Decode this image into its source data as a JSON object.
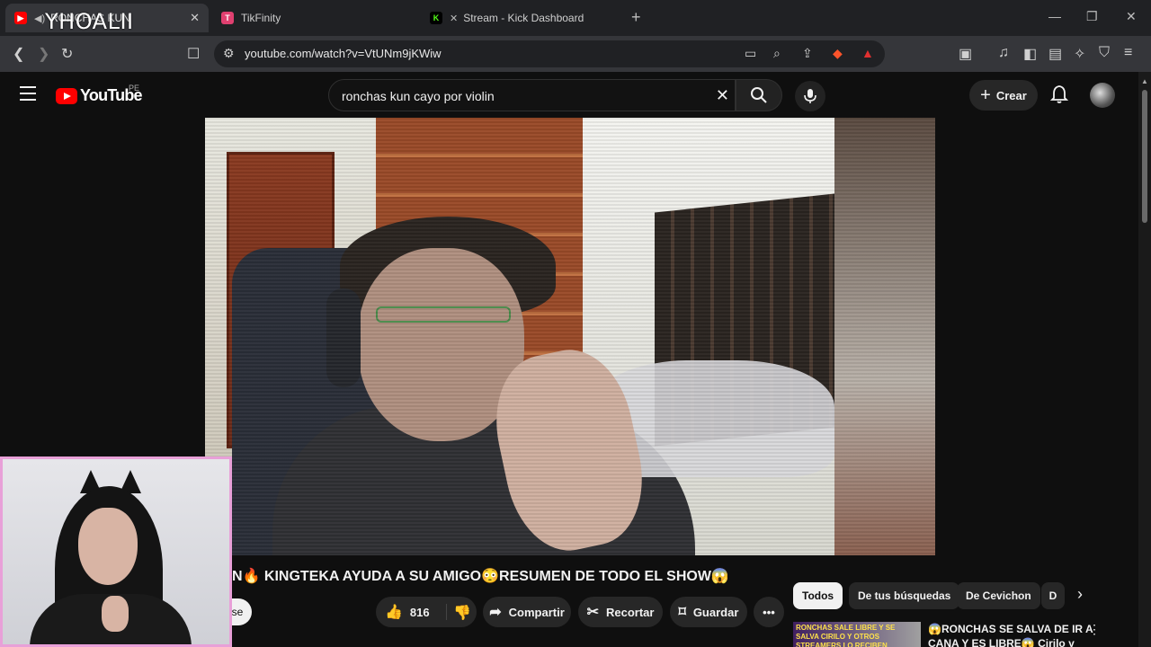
{
  "browser": {
    "tabs": [
      {
        "title": "RONCHAS KUN",
        "favicon": "youtube-favicon",
        "active": true
      },
      {
        "title": "TikFinity",
        "favicon": "tikfinity-favicon",
        "active": false
      },
      {
        "title": "Stream - Kick Dashboard",
        "favicon": "kick-favicon",
        "active": false
      }
    ],
    "overlay_text": "YHOALII",
    "url": "youtube.com/watch?v=VtUNm9jKWiw"
  },
  "youtube": {
    "logo_text": "YouTube",
    "country_code": "PE",
    "search_query": "ronchas kun cayo por violin",
    "create_label": "Crear"
  },
  "video": {
    "title": "N🔥 KINGTEKA AYUDA A SU AMIGO😳RESUMEN DE TODO EL SHOW😱",
    "subscribe_label_fragment": "se",
    "likes": "816",
    "share_label": "Compartir",
    "clip_label": "Recortar",
    "save_label": "Guardar"
  },
  "chips": [
    "Todos",
    "De tus búsquedas",
    "De Cevichon",
    "D"
  ],
  "recommendation": {
    "thumb_text": "RONCHAS SALE LIBRE Y SE SALVA CIRILO Y OTROS STREAMERS LO RECIBEN",
    "title": "😱RONCHAS SE SALVA DE IR A CANA Y ES LIBRE😱 Cirilo y"
  },
  "colors": {
    "brand_red": "#ff0000",
    "webcam_border": "#e8a0d8",
    "background": "#0f0f0f"
  }
}
